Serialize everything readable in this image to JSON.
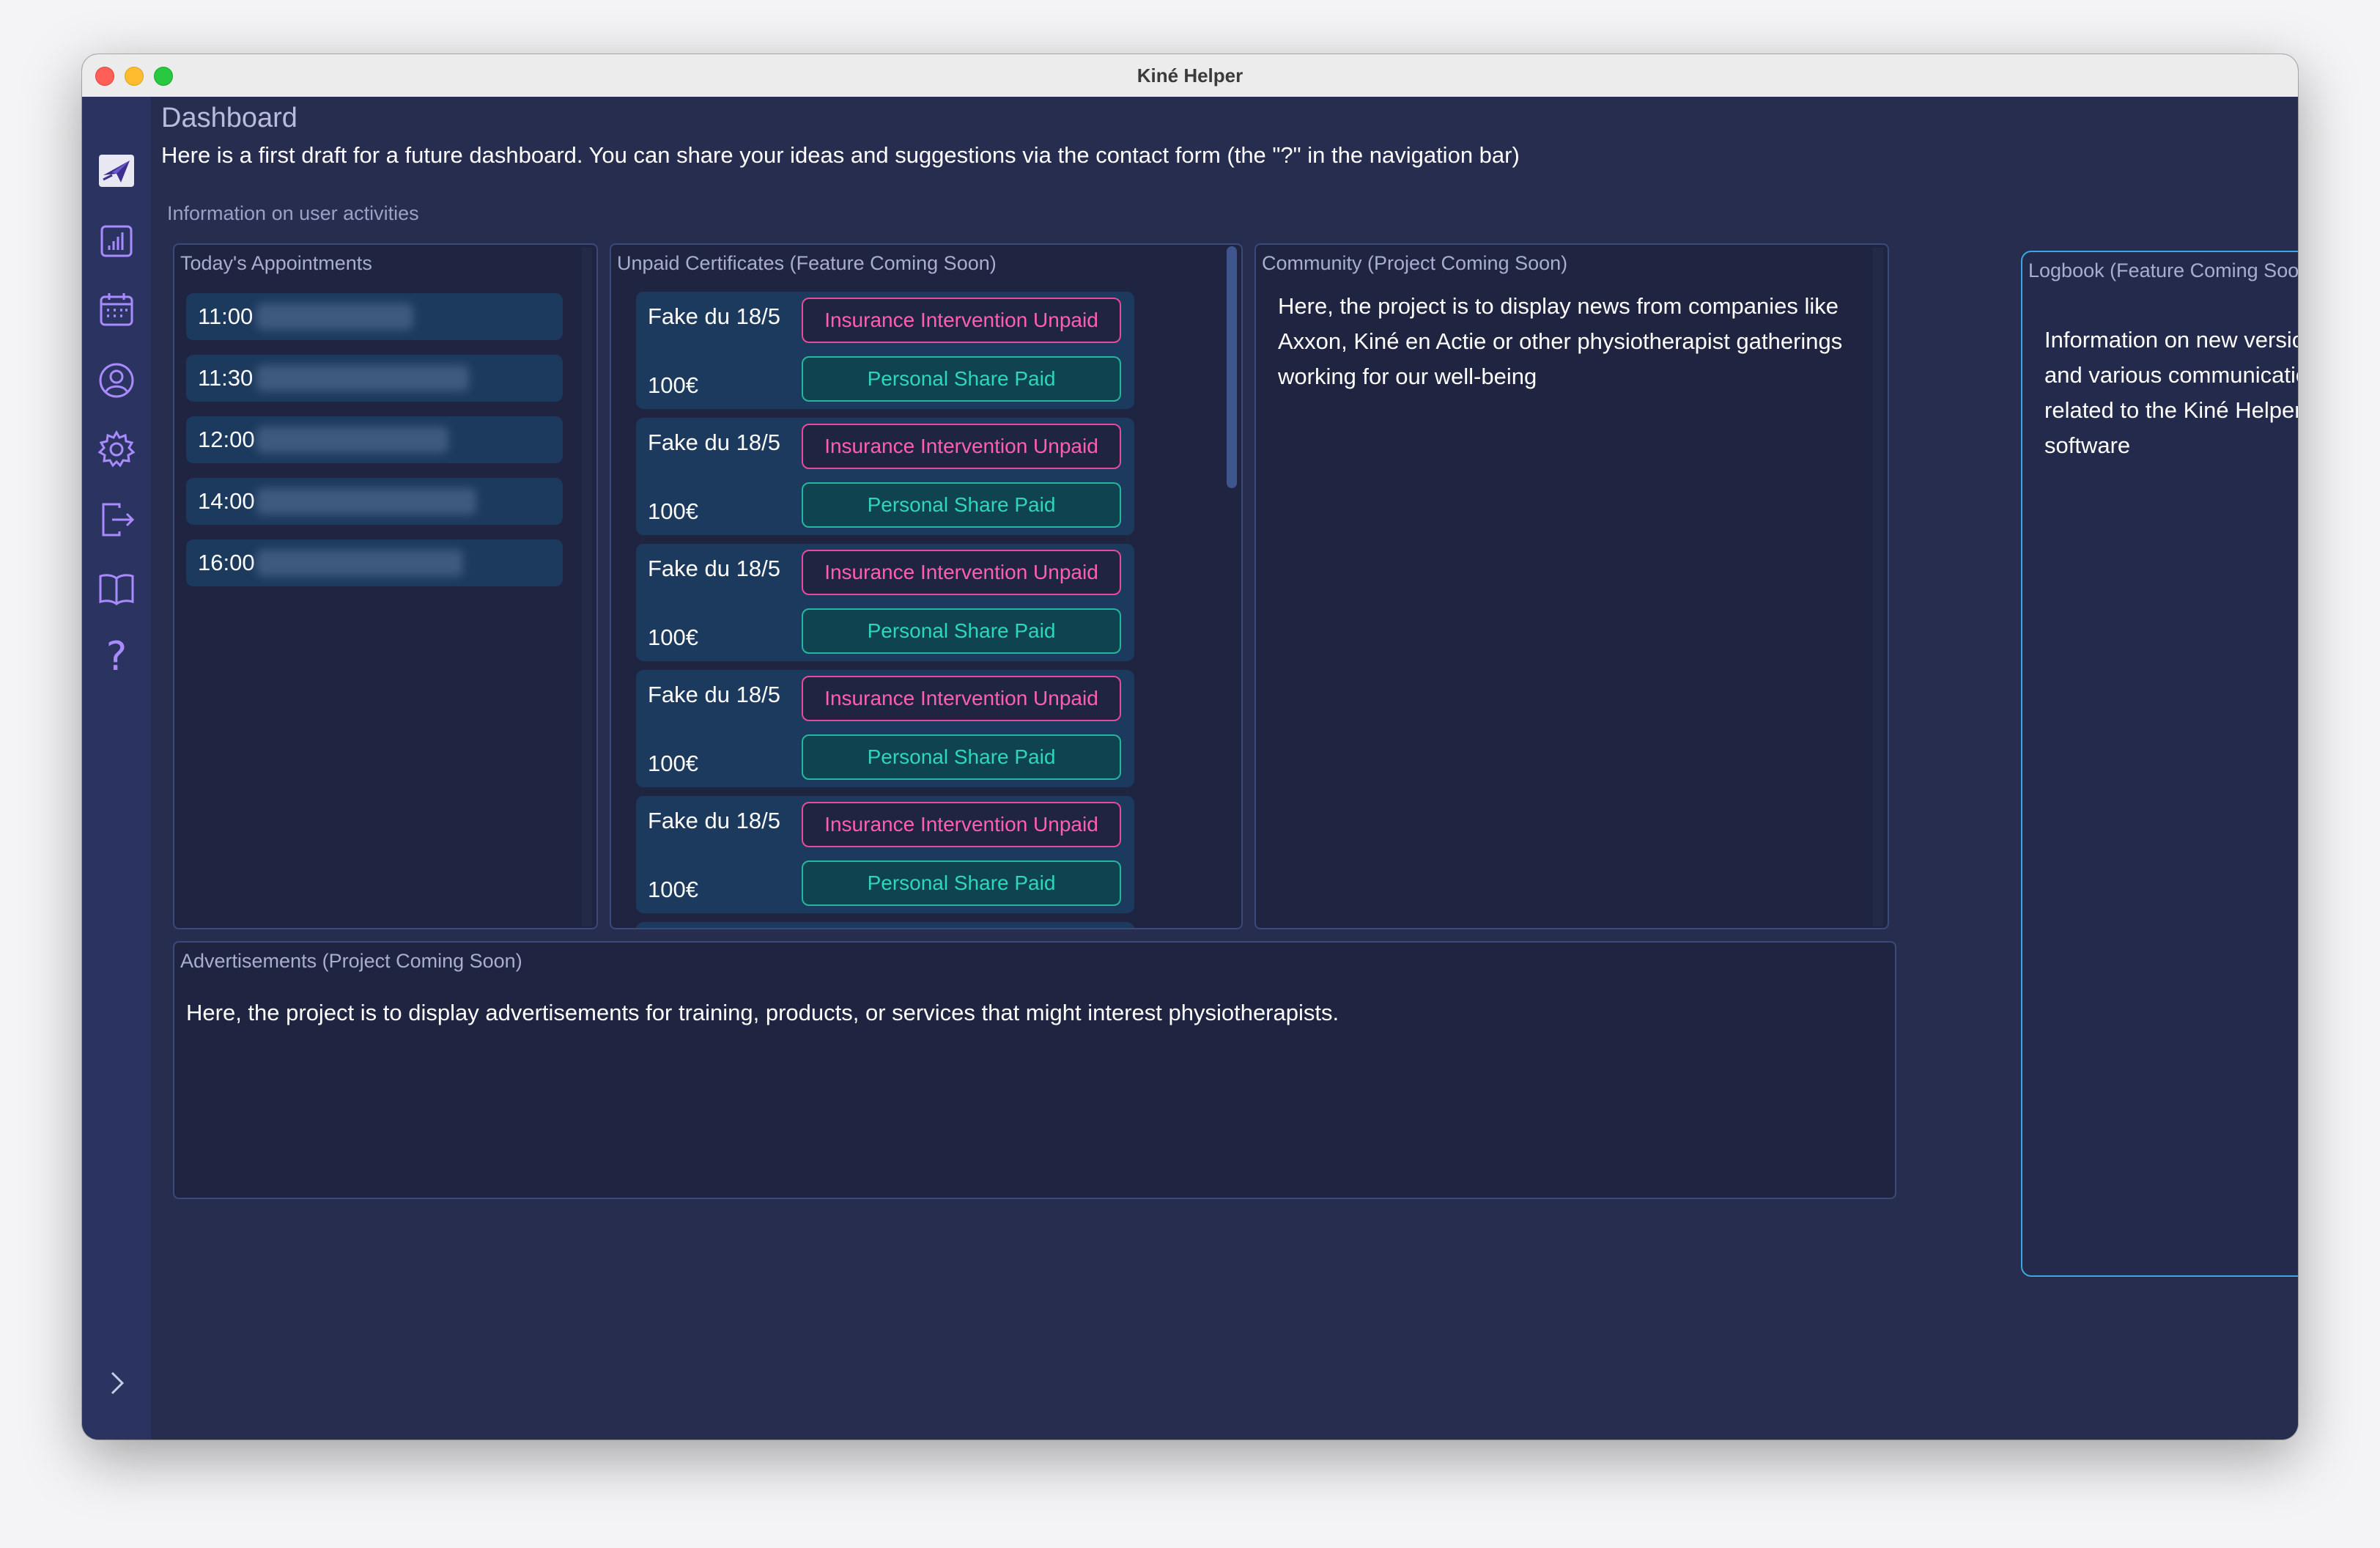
{
  "window": {
    "title": "Kiné Helper"
  },
  "sidebar": {
    "items": [
      {
        "icon": "paper-plane-icon"
      },
      {
        "icon": "bar-chart-icon"
      },
      {
        "icon": "calendar-icon"
      },
      {
        "icon": "user-circle-icon"
      },
      {
        "icon": "gear-icon"
      },
      {
        "icon": "logout-icon"
      },
      {
        "icon": "book-icon"
      },
      {
        "icon": "help-icon",
        "glyph": "?"
      }
    ],
    "expand_icon": "chevron-right-icon"
  },
  "header": {
    "title": "Dashboard",
    "intro": "Here is a first draft for a future dashboard. You can share your ideas and suggestions via the contact form (the \"?\" in the navigation bar)"
  },
  "user_activities": {
    "label": "Information on user activities",
    "appointments": {
      "title": "Today's Appointments",
      "items": [
        {
          "time": "11:00"
        },
        {
          "time": "11:30"
        },
        {
          "time": "12:00"
        },
        {
          "time": "14:00"
        },
        {
          "time": "16:00"
        }
      ]
    },
    "certificates": {
      "title": "Unpaid Certificates (Feature Coming Soon)",
      "items": [
        {
          "name": "Fake du 18/5",
          "amount": "100€",
          "insurance": "Insurance Intervention Unpaid",
          "personal": "Personal Share Paid"
        },
        {
          "name": "Fake du 18/5",
          "amount": "100€",
          "insurance": "Insurance Intervention Unpaid",
          "personal": "Personal Share Paid"
        },
        {
          "name": "Fake du 18/5",
          "amount": "100€",
          "insurance": "Insurance Intervention Unpaid",
          "personal": "Personal Share Paid"
        },
        {
          "name": "Fake du 18/5",
          "amount": "100€",
          "insurance": "Insurance Intervention Unpaid",
          "personal": "Personal Share Paid"
        },
        {
          "name": "Fake du 18/5",
          "amount": "100€",
          "insurance": "Insurance Intervention Unpaid",
          "personal": "Personal Share Paid"
        }
      ]
    },
    "community": {
      "title": "Community (Project Coming Soon)",
      "text": "Here, the project is to display news from companies like Axxon, Kiné en Actie or other physiotherapist gatherings working for our well-being"
    }
  },
  "advertisements": {
    "title": "Advertisements (Project Coming Soon)",
    "text": "Here, the project is to display advertisements for training, products, or services that might interest physiotherapists."
  },
  "logbook": {
    "title": "Logbook (Feature Coming Soon)",
    "text": "Information on new versions and various communications related to the Kiné Helper software"
  },
  "colors": {
    "background": "#262d4f",
    "sidebar": "#2b3461",
    "card": "#1c3a5e",
    "unpaid": "#ff5fb3",
    "paid": "#2fd6b8",
    "accent_border": "#3aa9e0"
  }
}
